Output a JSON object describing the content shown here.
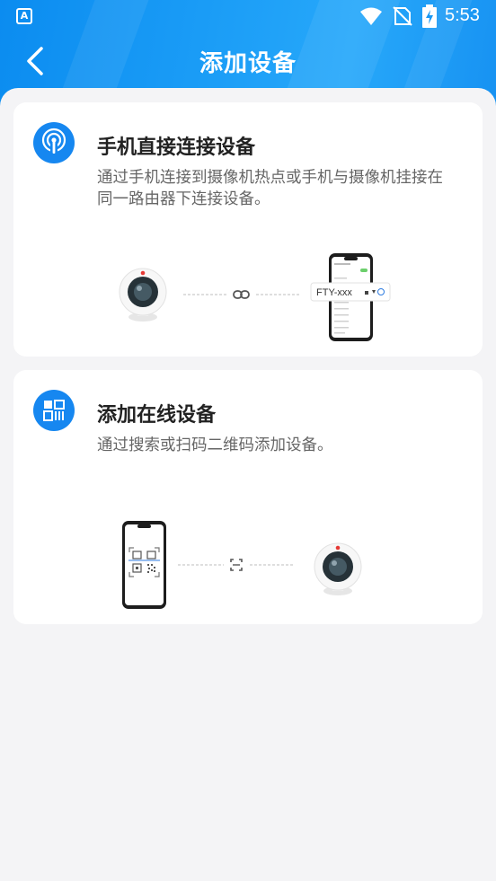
{
  "status_bar": {
    "time": "5:53",
    "app_badge": "A",
    "icons": [
      "wifi-icon",
      "no-sim-icon",
      "battery-charging-icon"
    ]
  },
  "header": {
    "title": "添加设备",
    "back_icon": "chevron-left-icon"
  },
  "cards": [
    {
      "icon": "wifi-hotspot-icon",
      "title": "手机直接连接设备",
      "description": "通过手机连接到摄像机热点或手机与摄像机挂接在同一路由器下连接设备。",
      "illustration": {
        "ssid_label": "FTY-xxx",
        "link_icon": "link-icon"
      }
    },
    {
      "icon": "qr-code-icon",
      "title": "添加在线设备",
      "description": "通过搜索或扫码二维码添加设备。",
      "illustration": {
        "scan_icon": "scan-icon"
      }
    }
  ],
  "colors": {
    "header_start": "#0b8cf0",
    "header_end": "#27a8fa",
    "accent": "#1687f0",
    "background": "#f4f4f6"
  }
}
